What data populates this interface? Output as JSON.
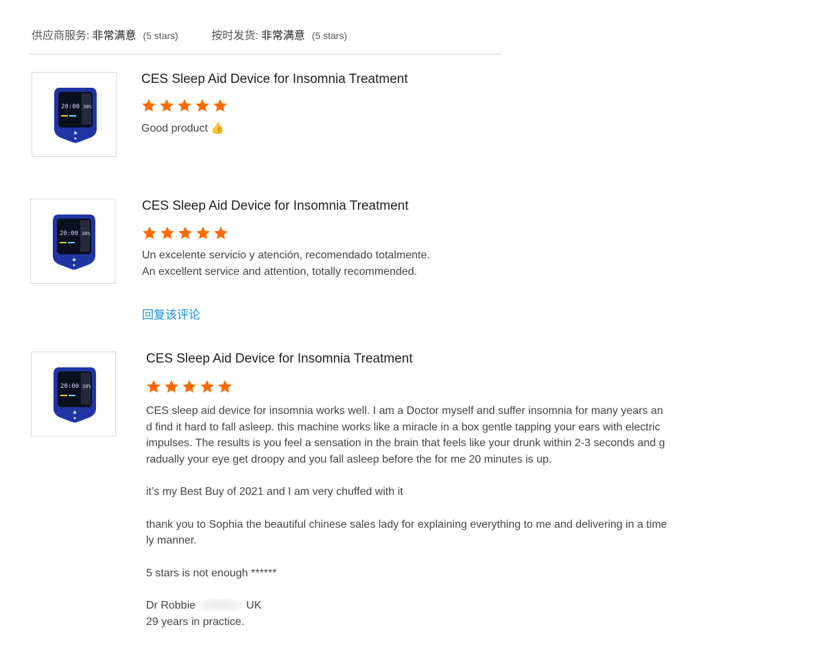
{
  "header": {
    "supplier_label": "供应商服务:",
    "supplier_value": "非常满意",
    "supplier_stars": "(5 stars)",
    "shipping_label": "按时发货:",
    "shipping_value": "非常满意",
    "shipping_stars": "(5 stars)"
  },
  "colors": {
    "star": "#ff6a00",
    "link": "#1a8cd8",
    "device": "#1f35a3"
  },
  "reviews": [
    {
      "product_title": "CES Sleep Aid Device for Insomnia Treatment",
      "rating": 5,
      "text": "Good product 👍"
    },
    {
      "product_title": "CES Sleep Aid Device for Insomnia Treatment",
      "rating": 5,
      "text_line1": "Un excelente servicio y atención, recomendado totalmente.",
      "text_line2": "An excellent service and attention, totally recommended.",
      "reply_link": "回复该评论"
    },
    {
      "product_title": "CES Sleep Aid Device for Insomnia Treatment",
      "rating": 5,
      "p1_l1": "CES sleep aid device for insomnia works well. I am a Doctor myself and suffer insomnia for many years an",
      "p1_l2": "d find it hard to fall asleep. this machine works like a miracle in a box gentle tapping your ears with electric",
      "p1_l3": "impulses. The results is you feel a sensation in the brain that feels like your drunk within 2-3 seconds and g",
      "p1_l4": "radually your eye get droopy and you fall asleep before the for me 20 minutes is up.",
      "p2": "it’s my Best Buy of 2021 and I am very chuffed with it",
      "p3_l1": "thank you to Sophia the beautiful chinese sales lady for explaining everything to me and delivering in a time",
      "p3_l2": "ly manner.",
      "p4": "5 stars is not enough ******",
      "sig_name": "Dr Robbie",
      "sig_country": "UK",
      "sig_line2": "29 years in practice."
    }
  ],
  "device_screen": {
    "time": "20:00",
    "percent": "30%"
  }
}
